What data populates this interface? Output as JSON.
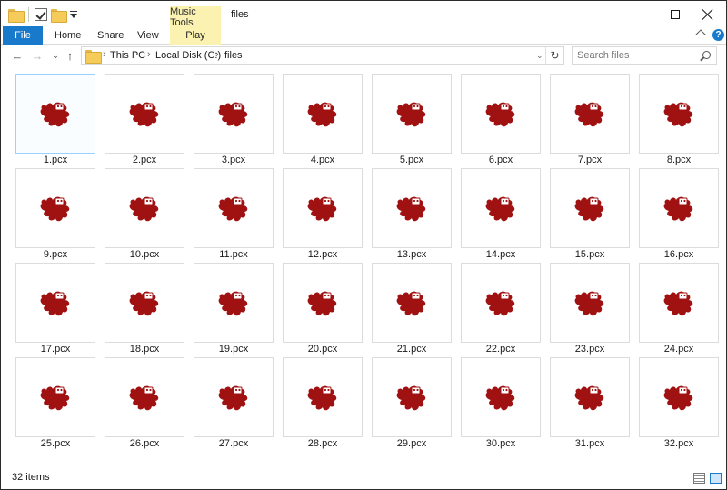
{
  "title_bar": {
    "contextual_tab_group": "Music Tools",
    "window_title": "files"
  },
  "ribbon": {
    "tabs": [
      "File",
      "Home",
      "Share",
      "View",
      "Play"
    ],
    "help": "?"
  },
  "address_bar": {
    "breadcrumbs": [
      "This PC",
      "Local Disk (C:)",
      "files"
    ],
    "search_placeholder": "Search files"
  },
  "files": [
    "1.pcx",
    "2.pcx",
    "3.pcx",
    "4.pcx",
    "5.pcx",
    "6.pcx",
    "7.pcx",
    "8.pcx",
    "9.pcx",
    "10.pcx",
    "11.pcx",
    "12.pcx",
    "13.pcx",
    "14.pcx",
    "15.pcx",
    "16.pcx",
    "17.pcx",
    "18.pcx",
    "19.pcx",
    "20.pcx",
    "21.pcx",
    "22.pcx",
    "23.pcx",
    "24.pcx",
    "25.pcx",
    "26.pcx",
    "27.pcx",
    "28.pcx",
    "29.pcx",
    "30.pcx",
    "31.pcx",
    "32.pcx"
  ],
  "selected_file": "1.pcx",
  "status_bar": {
    "item_count": "32 items"
  },
  "colors": {
    "accent": "#1979ca",
    "contextual_tab": "#fbf1b0",
    "file_icon": "#a01212"
  },
  "icons": {
    "file_icon": "pcx-image-icon"
  }
}
